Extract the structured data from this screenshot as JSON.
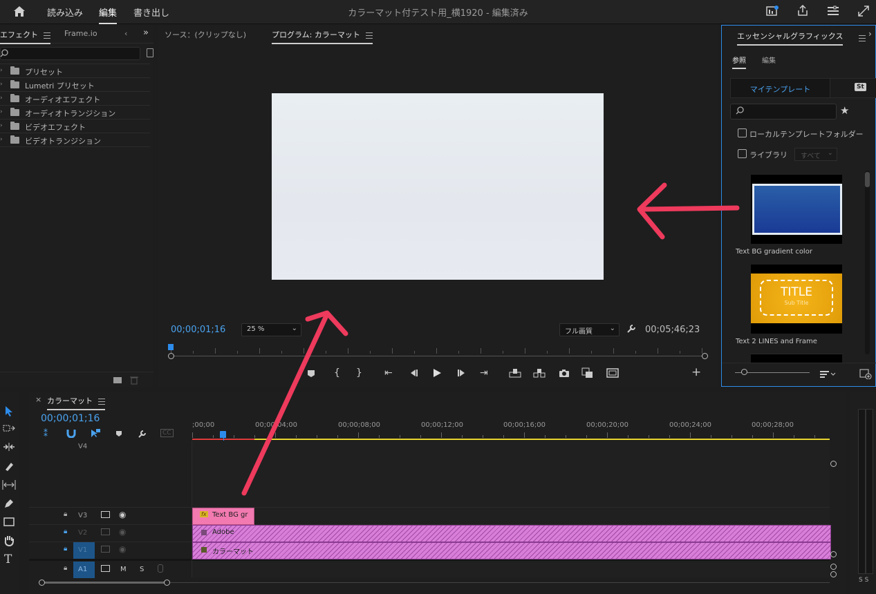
{
  "top_menu": {
    "items": [
      "読み込み",
      "編集",
      "書き出し"
    ],
    "active": "編集"
  },
  "project_title": "カラーマット付テスト用_横1920",
  "project_status": " - 編集済み",
  "effects_panel": {
    "tab_effects": "エフェクト",
    "tab_frameio": "Frame.io",
    "tree": [
      "プリセット",
      "Lumetri プリセット",
      "オーディオエフェクト",
      "オーディオトランジション",
      "ビデオエフェクト",
      "ビデオトランジション"
    ]
  },
  "monitor": {
    "source_tab": "ソース：(クリップなし)",
    "program_tab": "プログラム: カラーマット",
    "timecode": "00;00;01;16",
    "zoom": "25 %",
    "quality": "フル画質",
    "duration": "00;05;46;23",
    "playhead_fraction": 0.0
  },
  "essential_graphics": {
    "title": "エッセンシャルグラフィックス",
    "tab_browse": "参照",
    "tab_edit": "編集",
    "my_templates": "マイテンプレート",
    "st_badge": "St",
    "local_folder": "ローカルテンプレートフォルダー",
    "library": "ライブラリ",
    "library_select": "すべて",
    "templates": [
      {
        "name": "Text BG gradient color"
      },
      {
        "name": "Text 2 LINES and Frame",
        "thumb_title": "TITLE",
        "thumb_sub": "Sub Title"
      }
    ]
  },
  "timeline": {
    "sequence_name": "カラーマット",
    "timecode": "00;00;01;16",
    "ruler": [
      ";00;00",
      "00;00;04;00",
      "00;00;08;00",
      "00;00;12;00",
      "00;00;16;00",
      "00;00;20;00",
      "00;00;24;00",
      "00;00;28;00"
    ],
    "tracks": {
      "v4": "V4",
      "v3": "V3",
      "v2": "V2",
      "v1": "V1",
      "a1": "A1",
      "m": "M",
      "s": "S"
    },
    "clips": {
      "v3_clip": "Text BG gr",
      "v3_fx": "fx",
      "v2_clip": "Adobe",
      "v1_clip": "カラーマット"
    }
  },
  "audio_meter": {
    "labels": "S S"
  },
  "colors": {
    "accent_blue": "#2d8ceb",
    "clip_pink": "#f27ab0",
    "clip_violet": "#d87ed8",
    "annotation_red": "#ee3a5c",
    "work_area_yellow": "#e8d530"
  }
}
